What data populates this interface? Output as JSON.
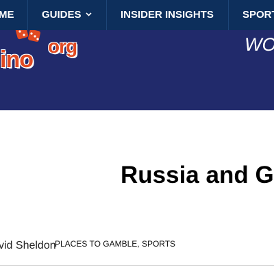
{
  "nav": {
    "items": [
      {
        "label": "ME"
      },
      {
        "label": "GUIDES"
      },
      {
        "label": "INSIDER INSIGHTS"
      },
      {
        "label": "SPORT"
      }
    ]
  },
  "header": {
    "logo": {
      "text": "ino",
      "suffix": "org"
    },
    "tagline": "WO"
  },
  "article": {
    "title": "Russia and G",
    "author": "vid Sheldon",
    "categories": "PLACES TO GAMBLE, SPORTS"
  },
  "colors": {
    "nav_bg": "#0d2f5c",
    "banner_bg": "#212a6b",
    "logo_orange": "#e14a22"
  },
  "icons": {
    "dropdown": "chevron-down-icon",
    "logo_dice": "dice-icon"
  }
}
